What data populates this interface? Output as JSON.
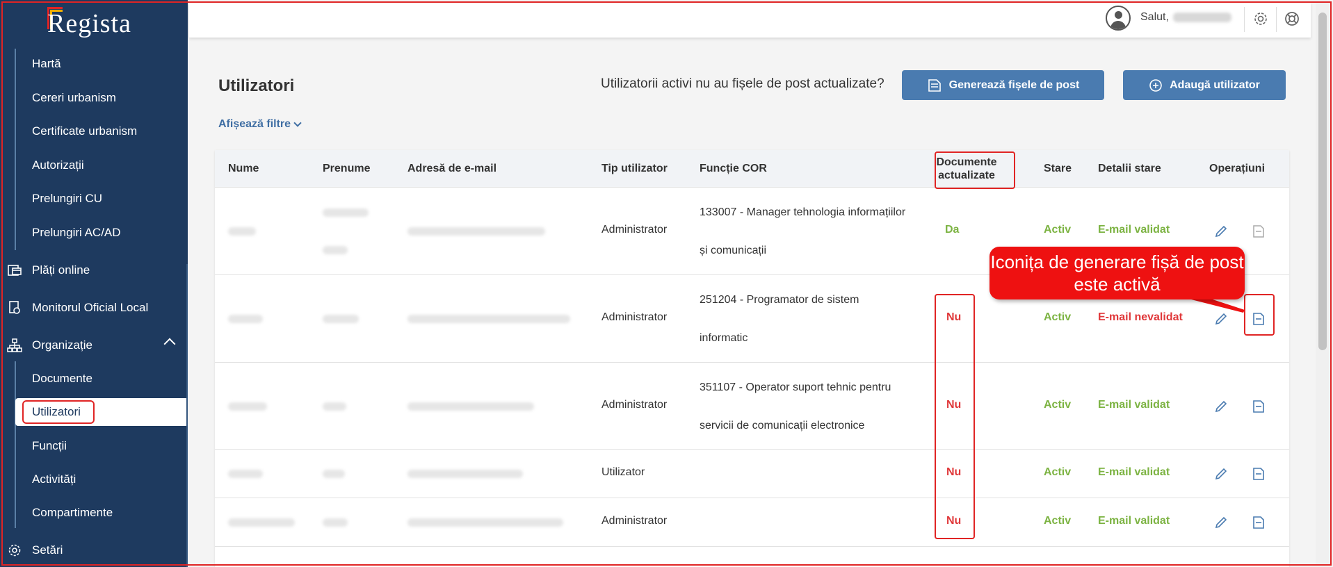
{
  "sidebar": {
    "logo": "Regista",
    "items": {
      "harta": "Hartă",
      "cereri": "Cereri urbanism",
      "certificate": "Certificate urbanism",
      "autorizatii": "Autorizații",
      "prelungiri_cu": "Prelungiri CU",
      "prelungiri_ac": "Prelungiri AC/AD",
      "plati": "Plăți online",
      "monitorul": "Monitorul Oficial Local",
      "organizatie": "Organizație",
      "documente": "Documente",
      "utilizatori": "Utilizatori",
      "functii": "Funcții",
      "activitati": "Activități",
      "compartimente": "Compartimente",
      "setari": "Setări"
    }
  },
  "topbar": {
    "greeting": "Salut,"
  },
  "main": {
    "title": "Utilizatori",
    "prompt": "Utilizatorii activi nu au fișele de post actualizate?",
    "generate_button": "Generează fișele de post",
    "add_button": "Adaugă utilizator",
    "filters": "Afișează filtre"
  },
  "table": {
    "headers": {
      "nume": "Nume",
      "prenume": "Prenume",
      "email": "Adresă de e-mail",
      "tip": "Tip utilizator",
      "functie": "Funcție COR",
      "documente_1": "Documente",
      "documente_2": "actualizate",
      "stare": "Stare",
      "detalii": "Detalii stare",
      "operatiuni": "Operațiuni"
    },
    "rows": [
      {
        "tip": "Administrator",
        "functie_1": "133007 - Manager tehnologia informațiilor",
        "functie_2": "și comunicații",
        "documente": "Da",
        "stare": "Activ",
        "detalii": "E-mail validat"
      },
      {
        "tip": "Administrator",
        "functie_1": "251204 - Programator de sistem",
        "functie_2": "informatic",
        "documente": "Nu",
        "stare": "Activ",
        "detalii": "E-mail nevalidat"
      },
      {
        "tip": "Administrator",
        "functie_1": "351107 - Operator suport tehnic pentru",
        "functie_2": "servicii de comunicații electronice",
        "documente": "Nu",
        "stare": "Activ",
        "detalii": "E-mail validat"
      },
      {
        "tip": "Utilizator",
        "functie_1": "",
        "functie_2": "",
        "documente": "Nu",
        "stare": "Activ",
        "detalii": "E-mail validat"
      },
      {
        "tip": "Administrator",
        "functie_1": "",
        "functie_2": "",
        "documente": "Nu",
        "stare": "Activ",
        "detalii": "E-mail validat"
      }
    ]
  },
  "annotation": {
    "callout": "Iconița de generare fișă de post este activă"
  },
  "colors": {
    "sidebar": "#1e3a5f",
    "accent": "#4a7bb0",
    "green": "#7cb342",
    "red": "#e0383a",
    "highlight": "#e02424"
  }
}
